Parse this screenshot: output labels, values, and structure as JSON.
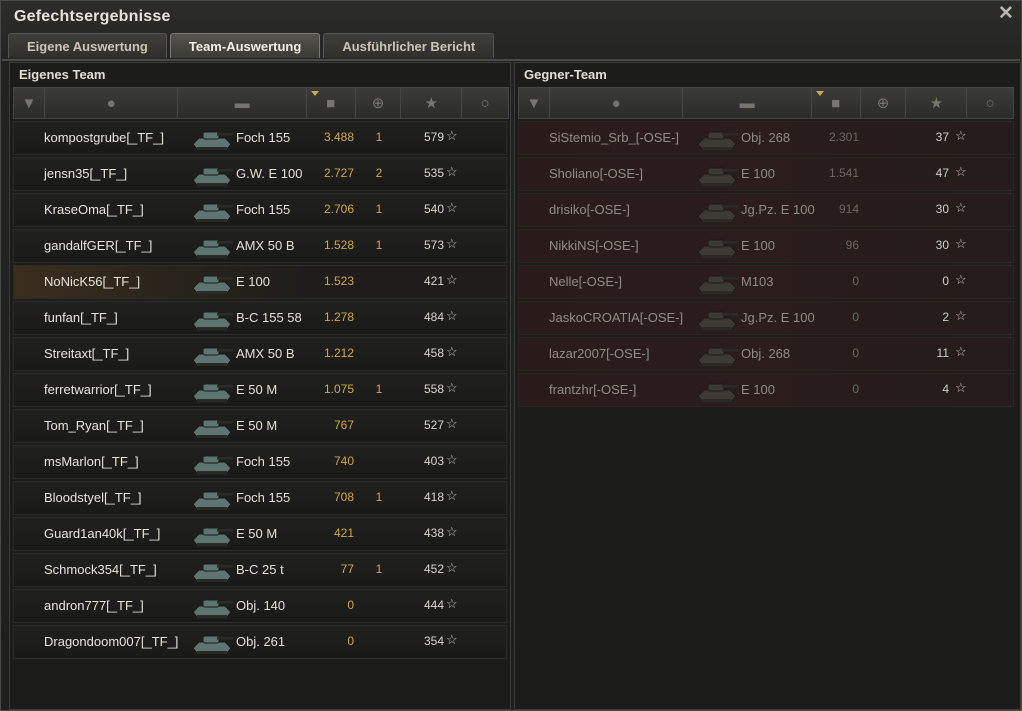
{
  "window": {
    "title": "Gefechtsergebnisse",
    "close_icon": "close-icon"
  },
  "tabs": [
    {
      "label": "Eigene Auswertung",
      "active": false
    },
    {
      "label": "Team-Auswertung",
      "active": true
    },
    {
      "label": "Ausführlicher Bericht",
      "active": false
    }
  ],
  "own_team": {
    "title": "Eigenes Team",
    "headers": [
      "squad-icon",
      "player-icon",
      "tank-icon",
      "damage-icon",
      "kills-icon",
      "xp-star-icon",
      "medal-icon"
    ],
    "sorted_column": "damage",
    "rows": [
      {
        "name": "kompostgrube[_TF_]",
        "tank": "Foch 155",
        "damage": "3.488",
        "kills": "1",
        "xp": "579",
        "player": false
      },
      {
        "name": "jensn35[_TF_]",
        "tank": "G.W. E 100",
        "damage": "2.727",
        "kills": "2",
        "xp": "535",
        "player": false
      },
      {
        "name": "KraseOma[_TF_]",
        "tank": "Foch 155",
        "damage": "2.706",
        "kills": "1",
        "xp": "540",
        "player": false
      },
      {
        "name": "gandalfGER[_TF_]",
        "tank": "AMX 50 B",
        "damage": "1.528",
        "kills": "1",
        "xp": "573",
        "player": false
      },
      {
        "name": "NoNicK56[_TF_]",
        "tank": "E 100",
        "damage": "1.523",
        "kills": "",
        "xp": "421",
        "player": true
      },
      {
        "name": "funfan[_TF_]",
        "tank": "B-C 155 58",
        "damage": "1.278",
        "kills": "",
        "xp": "484",
        "player": false
      },
      {
        "name": "Streitaxt[_TF_]",
        "tank": "AMX 50 B",
        "damage": "1.212",
        "kills": "",
        "xp": "458",
        "player": false
      },
      {
        "name": "ferretwarrior[_TF_]",
        "tank": "E 50 M",
        "damage": "1.075",
        "kills": "1",
        "xp": "558",
        "player": false
      },
      {
        "name": "Tom_Ryan[_TF_]",
        "tank": "E 50 M",
        "damage": "767",
        "kills": "",
        "xp": "527",
        "player": false
      },
      {
        "name": "msMarlon[_TF_]",
        "tank": "Foch 155",
        "damage": "740",
        "kills": "",
        "xp": "403",
        "player": false
      },
      {
        "name": "Bloodstyel[_TF_]",
        "tank": "Foch 155",
        "damage": "708",
        "kills": "1",
        "xp": "418",
        "player": false
      },
      {
        "name": "Guard1an40k[_TF_]",
        "tank": "E 50 M",
        "damage": "421",
        "kills": "",
        "xp": "438",
        "player": false
      },
      {
        "name": "Schmock354[_TF_]",
        "tank": "B-C 25 t",
        "damage": "77",
        "kills": "1",
        "xp": "452",
        "player": false
      },
      {
        "name": "andron777[_TF_]",
        "tank": "Obj. 140",
        "damage": "0",
        "kills": "",
        "xp": "444",
        "player": false
      },
      {
        "name": "Dragondoom007[_TF_]",
        "tank": "Obj. 261",
        "damage": "0",
        "kills": "",
        "xp": "354",
        "player": false
      }
    ]
  },
  "enemy_team": {
    "title": "Gegner-Team",
    "headers": [
      "squad-icon",
      "player-icon",
      "tank-icon",
      "damage-icon",
      "kills-icon",
      "xp-star-icon",
      "medal-icon"
    ],
    "sorted_column": "damage",
    "rows": [
      {
        "name": "SiStemio_Srb_[-OSE-]",
        "tank": "Obj. 268",
        "damage": "2.301",
        "kills": "",
        "xp": "37"
      },
      {
        "name": "Sholiano[-OSE-]",
        "tank": "E 100",
        "damage": "1.541",
        "kills": "",
        "xp": "47"
      },
      {
        "name": "drisiko[-OSE-]",
        "tank": "Jg.Pz. E 100",
        "damage": "914",
        "kills": "",
        "xp": "30"
      },
      {
        "name": "NikkiNS[-OSE-]",
        "tank": "E 100",
        "damage": "96",
        "kills": "",
        "xp": "30"
      },
      {
        "name": "Nelle[-OSE-]",
        "tank": "M103",
        "damage": "0",
        "kills": "",
        "xp": "0"
      },
      {
        "name": "JaskoCROATIA[-OSE-]",
        "tank": "Jg.Pz. E 100",
        "damage": "0",
        "kills": "",
        "xp": "2"
      },
      {
        "name": "lazar2007[-OSE-]",
        "tank": "Obj. 268",
        "damage": "0",
        "kills": "",
        "xp": "11"
      },
      {
        "name": "frantzhr[-OSE-]",
        "tank": "E 100",
        "damage": "0",
        "kills": "",
        "xp": "4"
      }
    ]
  },
  "star_glyph": "☆",
  "colors": {
    "damage": "#d3a64a",
    "player_highlight": "#3b2e1e",
    "enemy_row": "#2a1b1b",
    "tank_icon_own": "#5d7470",
    "tank_icon_enemy": "#3e3a33"
  }
}
